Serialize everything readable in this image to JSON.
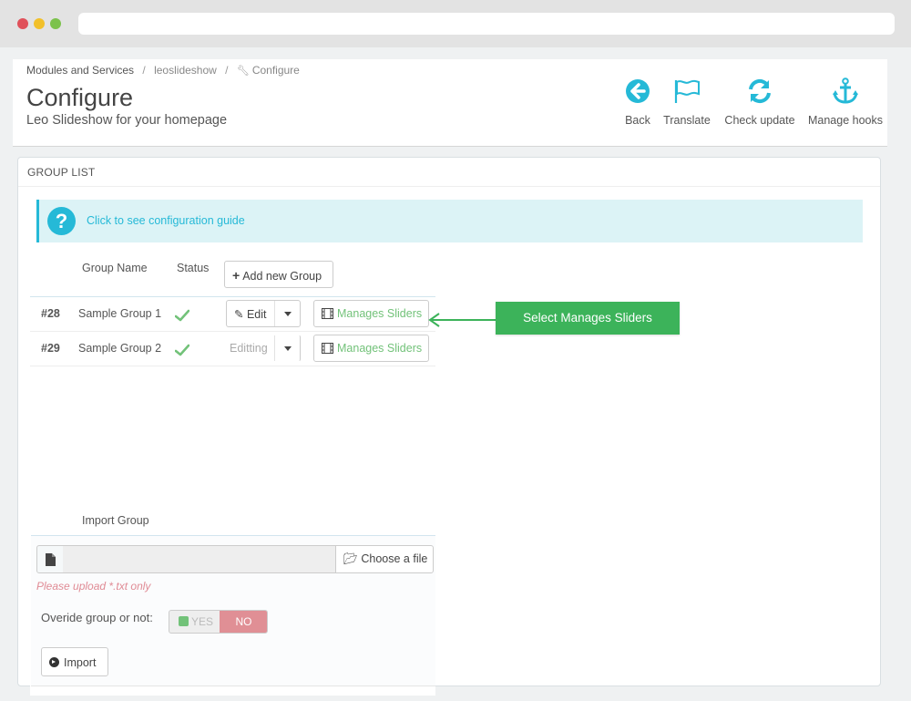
{
  "breadcrumb": {
    "items": [
      "Modules and Services",
      "leoslideshow",
      "Configure"
    ],
    "separator": "/"
  },
  "header": {
    "title": "Configure",
    "subtitle": "Leo Slideshow for your homepage"
  },
  "toolbar": {
    "back": "Back",
    "translate": "Translate",
    "check_update": "Check update",
    "manage_hooks": "Manage hooks",
    "icon_color": "#25b9d7"
  },
  "panel": {
    "heading": "GROUP LIST",
    "guide_link": "Click to see configuration guide"
  },
  "table": {
    "col_name": "Group Name",
    "col_status": "Status",
    "add_button": "Add new Group",
    "rows": [
      {
        "id": "#28",
        "name": "Sample Group 1",
        "status": "enabled",
        "action": "Edit",
        "manage": "Manages Sliders"
      },
      {
        "id": "#29",
        "name": "Sample Group 2",
        "status": "enabled",
        "action": "Editting",
        "manage": "Manages Sliders"
      }
    ]
  },
  "callout": {
    "text": "Select Manages Sliders",
    "color": "#3cb35a"
  },
  "import": {
    "title": "Import Group",
    "choose_file": "Choose a file",
    "hint": "Please upload *.txt only",
    "override_label": "Overide group or not:",
    "yes_label": "YES",
    "no_label": "NO",
    "import_button": "Import"
  }
}
